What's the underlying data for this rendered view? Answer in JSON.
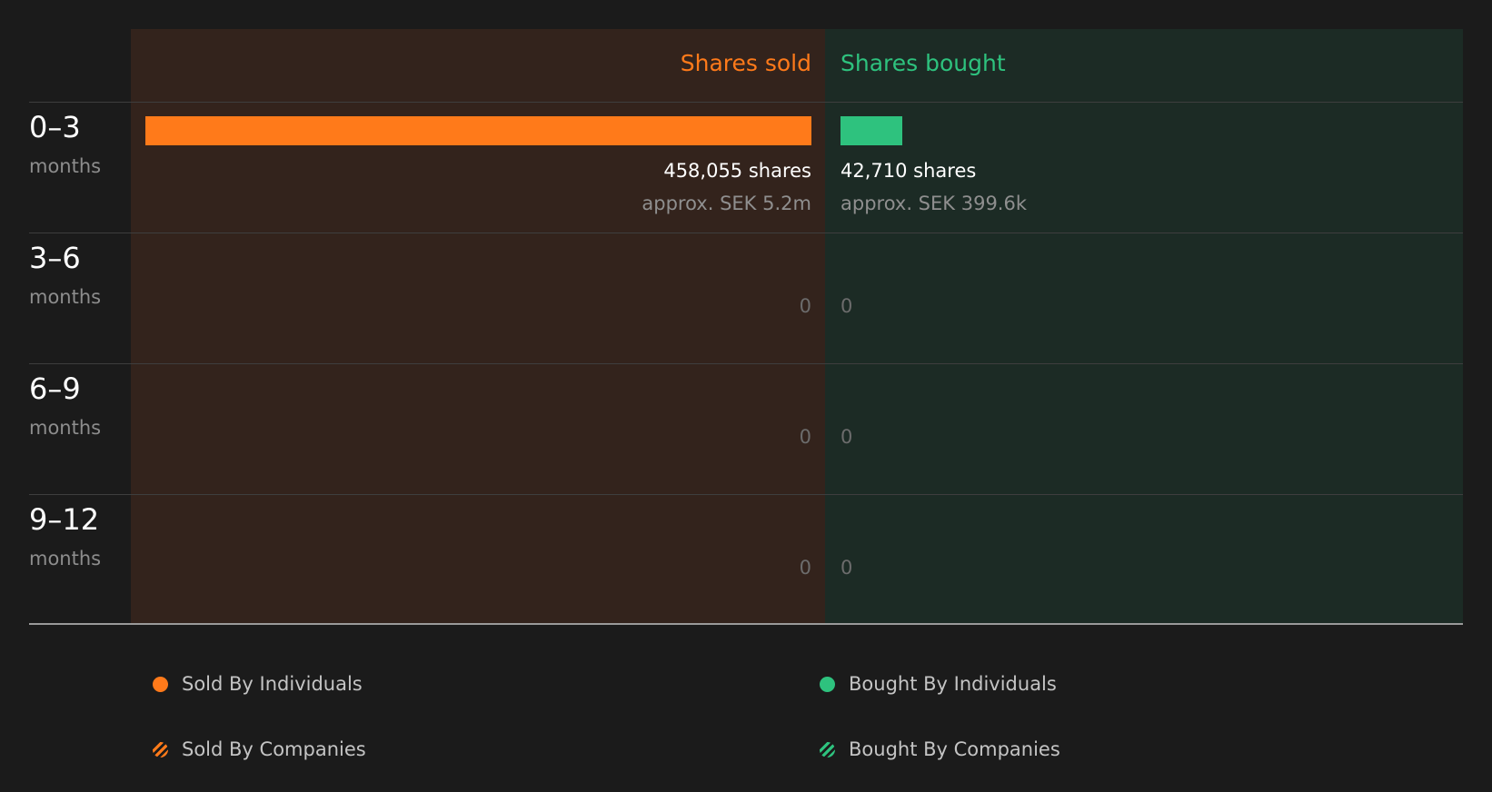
{
  "colors": {
    "sold": "#ff7a1a",
    "bought": "#2ec27e",
    "sold_panel": "#33231c",
    "bought_panel": "#1c2b25",
    "background": "#1b1b1b"
  },
  "headers": {
    "sold": "Shares sold",
    "bought": "Shares bought"
  },
  "chart_data": {
    "type": "bar",
    "categories": [
      "0–3 months",
      "3–6 months",
      "6–9 months",
      "9–12 months"
    ],
    "series": [
      {
        "name": "Shares sold",
        "values": [
          458055,
          0,
          0,
          0
        ]
      },
      {
        "name": "Shares bought",
        "values": [
          42710,
          0,
          0,
          0
        ]
      }
    ]
  },
  "rows": [
    {
      "range": "0–3",
      "unit": "months",
      "sold": {
        "value": 458055,
        "shares_label": "458,055 shares",
        "approx_label": "approx. SEK 5.2m"
      },
      "bought": {
        "value": 42710,
        "shares_label": "42,710 shares",
        "approx_label": "approx. SEK 399.6k"
      }
    },
    {
      "range": "3–6",
      "unit": "months",
      "sold": {
        "value": 0,
        "zero_label": "0"
      },
      "bought": {
        "value": 0,
        "zero_label": "0"
      }
    },
    {
      "range": "6–9",
      "unit": "months",
      "sold": {
        "value": 0,
        "zero_label": "0"
      },
      "bought": {
        "value": 0,
        "zero_label": "0"
      }
    },
    {
      "range": "9–12",
      "unit": "months",
      "sold": {
        "value": 0,
        "zero_label": "0"
      },
      "bought": {
        "value": 0,
        "zero_label": "0"
      }
    }
  ],
  "legend": [
    {
      "label": "Sold By Individuals",
      "icon": "solid-dot-icon",
      "color": "#ff7a1a"
    },
    {
      "label": "Bought By Individuals",
      "icon": "solid-dot-icon",
      "color": "#2ec27e"
    },
    {
      "label": "Sold By Companies",
      "icon": "hatched-dot-icon",
      "color": "#ff7a1a"
    },
    {
      "label": "Bought By Companies",
      "icon": "hatched-dot-icon",
      "color": "#2ec27e"
    }
  ]
}
